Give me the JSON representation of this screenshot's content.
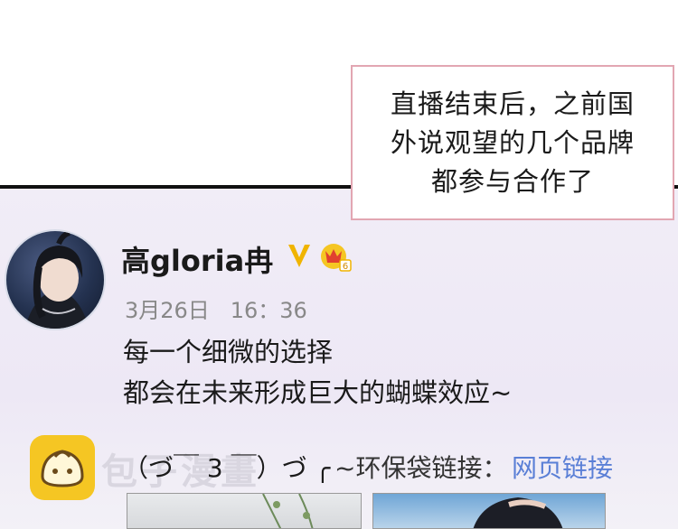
{
  "caption": {
    "text_line1": "直播结束后，之前国",
    "text_line2": "外说观望的几个品牌",
    "text_line3": "都参与合作了"
  },
  "post": {
    "username": "高gloria冉",
    "verified_badge": "V",
    "timestamp": "3月26日   16：36",
    "body_line1": "每一个细微的选择",
    "body_line2": "都会在未来形成巨大的蝴蝶效应~",
    "kaomoji": "（づ￣ 3 ￣）づ ╭",
    "link_prefix": "~环保袋链接：",
    "link_text": "网页链接"
  },
  "watermark": {
    "text": "包子漫畫"
  },
  "colors": {
    "caption_border": "#e2a6b2",
    "link": "#5a7fd6",
    "panel_bg": "#efeaf6",
    "app_logo": "#f5c623",
    "verified": "#f0b400"
  }
}
